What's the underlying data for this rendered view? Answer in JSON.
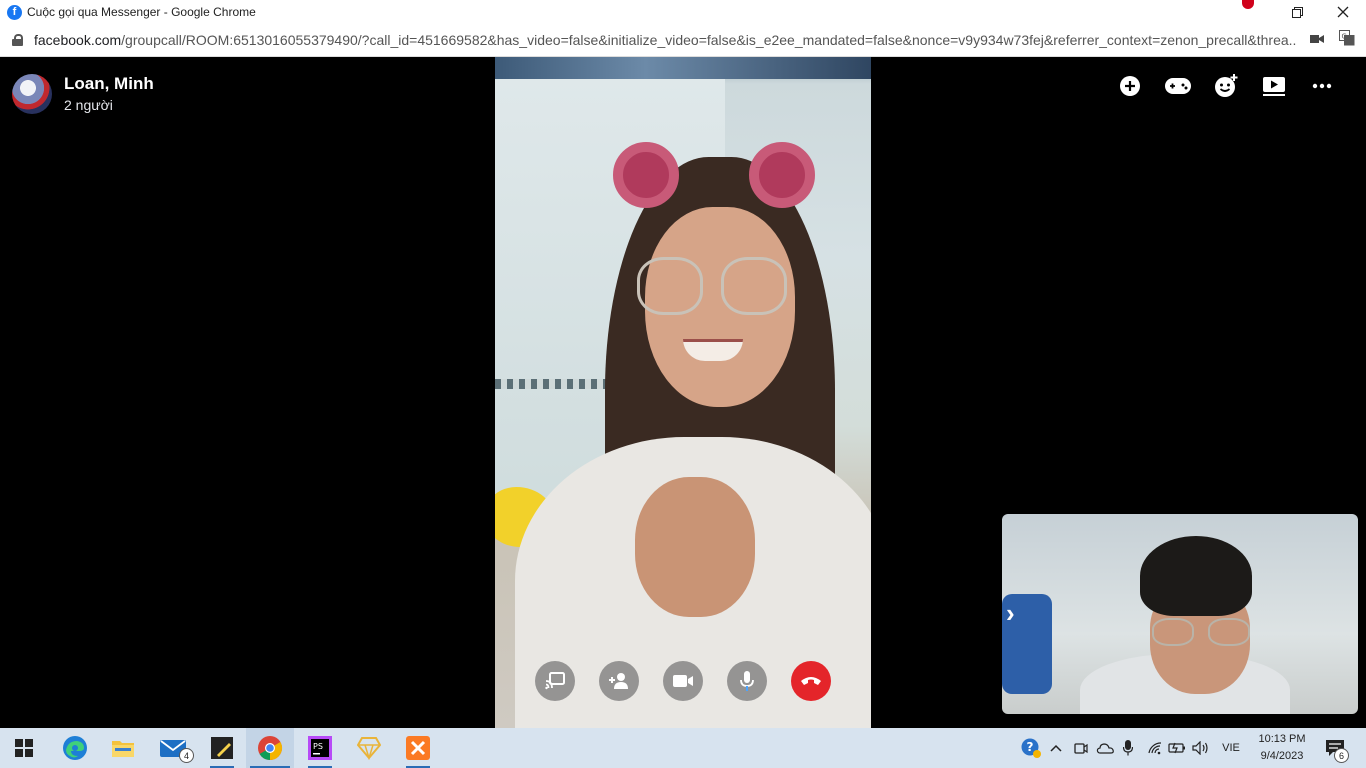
{
  "window": {
    "title": "Cuộc gọi qua Messenger - Google Chrome",
    "favicon": "facebook-icon"
  },
  "address": {
    "host": "facebook.com",
    "path": "/groupcall/ROOM:6513016055379490/?call_id=451669582&has_video=false&initialize_video=false&is_e2ee_mandated=false&nonce=v9y934w73fej&referrer_context=zenon_precall&threa..."
  },
  "call": {
    "name": "Loan, Minh",
    "participants": "2 người",
    "top_actions": [
      "add-icon",
      "game-controller-icon",
      "effects-icon",
      "play-icon",
      "more-icon"
    ],
    "controls": [
      "share-screen-icon",
      "add-person-icon",
      "video-camera-icon",
      "microphone-icon",
      "end-call-icon"
    ]
  },
  "taskbar": {
    "apps": [
      "windows-start-icon",
      "edge-icon",
      "file-explorer-icon",
      "mail-icon",
      "sticky-notes-icon",
      "chrome-icon",
      "phpstorm-icon",
      "sketch-icon",
      "xampp-icon"
    ],
    "mail_badge": "4",
    "language": "VIE",
    "time": "10:13 PM",
    "date": "9/4/2023",
    "notifications": "6"
  },
  "colors": {
    "end_call": "#e4252a",
    "facebook_blue": "#1877f2",
    "taskbar": "#d7e3ef"
  }
}
